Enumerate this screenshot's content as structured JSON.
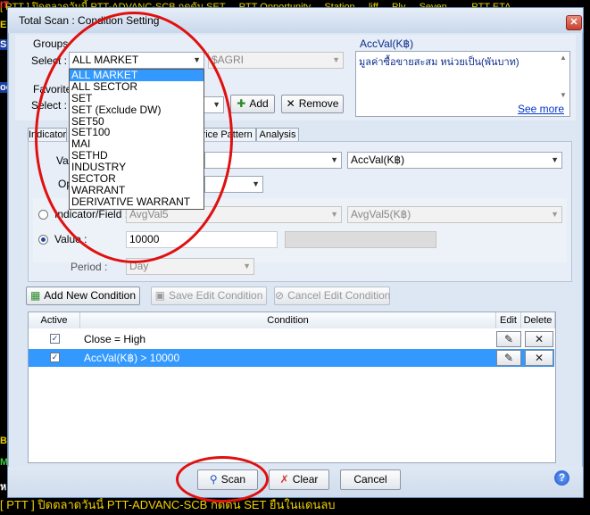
{
  "background": {
    "top_text": "[ PTT ] ปิดตลาดวันนี้ PTT-ADVANC-SCB กดดัน SET ... PTT Opportunity ... Station ... liff ... Ply ... Seven ... ... PTT ETA",
    "left_labels": [
      "IT",
      "E",
      "S",
      "oc",
      "BL",
      "MC",
      "ห"
    ],
    "bottom_text": "[ PTT ] ปิดตลาดวันนี้ PTT-ADVANC-SCB กดดัน SET ยืนในแดนลบ"
  },
  "dialog": {
    "title": "Total Scan : Condition Setting",
    "close_glyph": "✕",
    "groups": {
      "label": "Groups",
      "select_label": "Select :",
      "select_value": "ALL MARKET",
      "second_combo": "$AGRI",
      "options": [
        "ALL MARKET",
        "ALL SECTOR",
        "SET",
        "SET (Exclude DW)",
        "SET50",
        "SET100",
        "MAI",
        "SETHD",
        "INDUSTRY",
        "SECTOR",
        "WARRANT",
        "DERIVATIVE WARRANT"
      ]
    },
    "favorite": {
      "label": "Favorites",
      "select_label": "Select :",
      "add_label": "Add",
      "remove_label": "Remove"
    },
    "description": {
      "title": "AccVal(K฿)",
      "text": "มูลค่าซื้อขายสะสม หน่วยเป็น(พันบาท)",
      "see_more": "See more"
    },
    "tabs": [
      "Indicator",
      "Price Pattern",
      "Analysis"
    ],
    "condition": {
      "value_label": "Va",
      "value_combo": "AccVal(K฿)",
      "operator_label": "Op",
      "indicator_label": "Indicator/Field :",
      "indicator_combo1": "AvgVal5",
      "indicator_combo2": "AvgVal5(K฿)",
      "value_radio_label": "Value :",
      "value_input": "10000",
      "period_label": "Period :",
      "period_value": "Day"
    },
    "actions": {
      "add_new": "Add New Condition",
      "save_edit": "Save Edit Condition",
      "cancel_edit": "Cancel Edit Condition"
    },
    "grid": {
      "headers": [
        "Active",
        "Condition",
        "Edit",
        "Delete"
      ],
      "rows": [
        {
          "active": "✓",
          "condition": "Close = High"
        },
        {
          "active": "✓",
          "condition": "AccVal(K฿) > 10000"
        }
      ]
    },
    "footer": {
      "scan": "Scan",
      "clear": "Clear",
      "cancel": "Cancel",
      "help": "?"
    }
  },
  "colors": {
    "annotation": "#e01010",
    "selection": "#3399ff"
  }
}
